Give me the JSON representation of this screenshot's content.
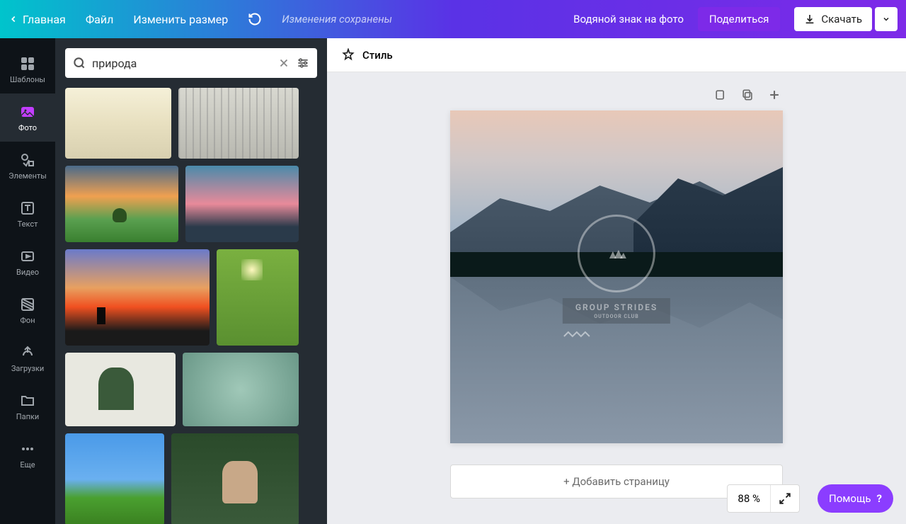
{
  "topbar": {
    "home": "Главная",
    "file": "Файл",
    "resize": "Изменить размер",
    "save_status": "Изменения сохранены",
    "watermark": "Водяной знак на фото",
    "share": "Поделиться",
    "download": "Скачать"
  },
  "sidebar": {
    "items": [
      {
        "label": "Шаблоны"
      },
      {
        "label": "Фото"
      },
      {
        "label": "Элементы"
      },
      {
        "label": "Текст"
      },
      {
        "label": "Видео"
      },
      {
        "label": "Фон"
      },
      {
        "label": "Загрузки"
      },
      {
        "label": "Папки"
      },
      {
        "label": "Еще"
      }
    ]
  },
  "search": {
    "value": "природа"
  },
  "style_bar": {
    "label": "Стиль"
  },
  "canvas": {
    "watermark_title": "GROUP STRIDES",
    "watermark_sub": "OUTDOOR CLUB"
  },
  "add_page": "+ Добавить страницу",
  "zoom": {
    "value": "88 %"
  },
  "help": {
    "label": "Помощь",
    "q": "?"
  }
}
